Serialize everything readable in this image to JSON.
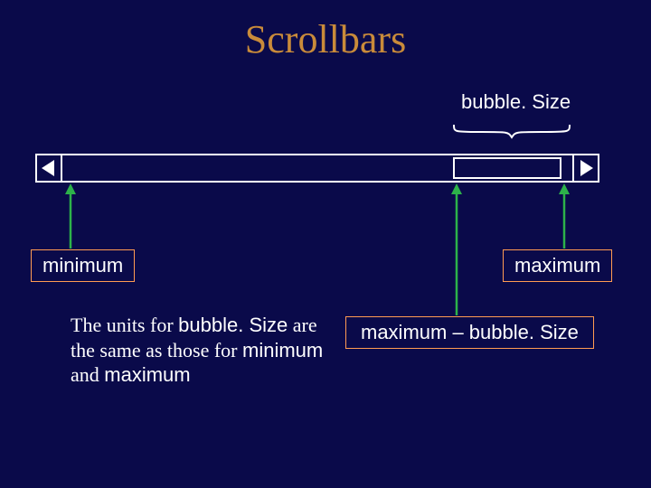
{
  "title": "Scrollbars",
  "labels": {
    "bubbleSize": "bubble. Size",
    "minimum": "minimum",
    "maximum": "maximum",
    "maxMinusBubble": "maximum – bubble. Size"
  },
  "paragraph": {
    "p1": "The units for ",
    "code1": "bubble. Size",
    "p2": " are the same as those for ",
    "code2": "minimum",
    "p3": " and ",
    "code3": "maximum"
  },
  "colors": {
    "background": "#0a0a4a",
    "titleColor": "#c98b3a",
    "boxBorder": "#ff9b52",
    "arrowColor": "#2db24a"
  },
  "scrollbar": {
    "leftArrow": "left-arrow",
    "rightArrow": "right-arrow",
    "thumbPositionFraction": 0.77,
    "thumbWidthFraction": 0.21
  }
}
